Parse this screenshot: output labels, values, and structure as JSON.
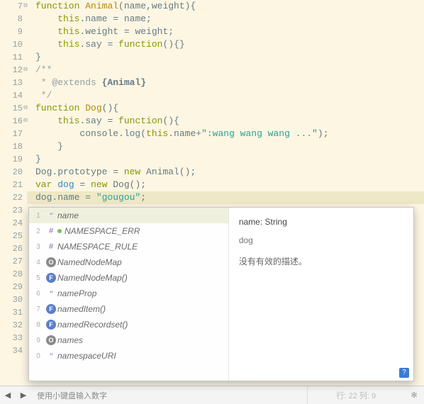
{
  "lines": [
    {
      "n": 7,
      "fold": true,
      "html": "<span class='kw'>function</span> <span class='fn'>Animal</span>(name,weight){"
    },
    {
      "n": 8,
      "html": "    <span class='kw'>this</span>.name = name;"
    },
    {
      "n": 9,
      "html": "    <span class='kw'>this</span>.weight = weight;"
    },
    {
      "n": 10,
      "html": "    <span class='kw'>this</span>.say = <span class='kw'>function</span>(){}"
    },
    {
      "n": 11,
      "html": "}"
    },
    {
      "n": 12,
      "fold": true,
      "html": "<span class='doc'>/**</span>"
    },
    {
      "n": 13,
      "html": "<span class='doc'> * @extends </span><span class='tag'>{Animal}</span>"
    },
    {
      "n": 14,
      "html": "<span class='doc'> */</span>"
    },
    {
      "n": 15,
      "fold": true,
      "html": "<span class='kw'>function</span> <span class='fn'>Dog</span>(){"
    },
    {
      "n": 16,
      "fold": true,
      "html": "    <span class='kw'>this</span>.say = <span class='kw'>function</span>(){"
    },
    {
      "n": 17,
      "html": "        console.log(<span class='kw'>this</span>.name+<span class='str'>\":wang wang wang ...\"</span>);"
    },
    {
      "n": 18,
      "html": "    }"
    },
    {
      "n": 19,
      "html": "}"
    },
    {
      "n": 20,
      "html": "Dog.prototype = <span class='kw'>new</span> Animal();"
    },
    {
      "n": 21,
      "html": "<span class='kw'>var</span> <span class='id'>dog</span> = <span class='kw'>new</span> Dog();"
    },
    {
      "n": 22,
      "hl": true,
      "html": "dog.name = <span class='str'>\"gougou\"</span>;"
    },
    {
      "n": 23,
      "html": ""
    },
    {
      "n": 24,
      "html": ""
    },
    {
      "n": 25,
      "html": ""
    },
    {
      "n": 26,
      "html": ""
    },
    {
      "n": 27,
      "html": ""
    },
    {
      "n": 28,
      "html": ""
    },
    {
      "n": 29,
      "html": ""
    },
    {
      "n": 30,
      "html": ""
    },
    {
      "n": 31,
      "html": ""
    },
    {
      "n": 32,
      "html": ""
    },
    {
      "n": 33,
      "html": ""
    },
    {
      "n": 34,
      "html": ""
    }
  ],
  "ac": {
    "items": [
      {
        "idx": "1",
        "iconName": "property-icon",
        "iconClass": "ic-prop",
        "icon": "“",
        "label": "name",
        "sel": true
      },
      {
        "idx": "2",
        "iconName": "hash-icon",
        "iconClass": "ic-hash",
        "icon": "#",
        "label": "NAMESPACE_ERR",
        "dot": true
      },
      {
        "idx": "3",
        "iconName": "hash-icon",
        "iconClass": "ic-hash",
        "icon": "#",
        "label": "NAMESPACE_RULE"
      },
      {
        "idx": "4",
        "iconName": "object-icon",
        "iconClass": "ic-o",
        "icon": "O",
        "label": "NamedNodeMap"
      },
      {
        "idx": "5",
        "iconName": "function-icon",
        "iconClass": "ic-f",
        "icon": "F",
        "label": "NamedNodeMap()"
      },
      {
        "idx": "6",
        "iconName": "property-icon",
        "iconClass": "ic-prop",
        "icon": "“",
        "label": "nameProp"
      },
      {
        "idx": "7",
        "iconName": "function-icon",
        "iconClass": "ic-f",
        "icon": "F",
        "label": "namedItem()"
      },
      {
        "idx": "8",
        "iconName": "function-icon",
        "iconClass": "ic-f",
        "icon": "F",
        "label": "namedRecordset()"
      },
      {
        "idx": "9",
        "iconName": "object-icon",
        "iconClass": "ic-o",
        "icon": "O",
        "label": "names"
      },
      {
        "idx": "0",
        "iconName": "property-icon",
        "iconClass": "ic-prop",
        "icon": "“",
        "label": "namespaceURI"
      }
    ],
    "detail": {
      "signature": "name: String",
      "scope": "dog",
      "description": "没有有效的描述。"
    },
    "help": "?"
  },
  "status": {
    "back": "◀",
    "play": "▶",
    "hint": "使用小键盘输入数字",
    "position": "行: 22 列: 9",
    "gear": "✻"
  }
}
